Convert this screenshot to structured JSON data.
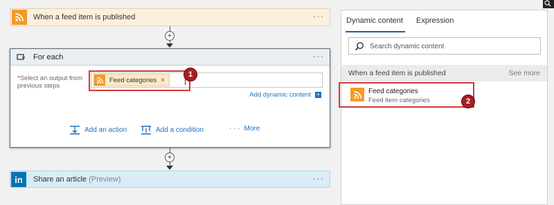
{
  "trigger": {
    "title": "When a feed item is published",
    "more": "···",
    "icon": "rss-icon"
  },
  "foreach": {
    "title": "For each",
    "more": "···",
    "required_star": "*",
    "field_label": "Select an output from previous steps",
    "token_label": "Feed categories",
    "token_remove": "×",
    "add_dynamic_content": "Add dynamic content",
    "add_dynamic_icon": "+",
    "actions": {
      "add_action": "Add an action",
      "add_condition": "Add a condition",
      "more": "More",
      "more_dots": "· · ·"
    }
  },
  "share": {
    "title": "Share an article",
    "preview": "(Preview)",
    "more": "···",
    "icon_text": "in"
  },
  "connectors": {
    "plus": "+"
  },
  "callouts": {
    "badge1": "1",
    "badge2": "2"
  },
  "panel": {
    "tabs": [
      "Dynamic content",
      "Expression"
    ],
    "search_placeholder": "Search dynamic content",
    "section_title": "When a feed item is published",
    "see_more": "See more",
    "item": {
      "name": "Feed categories",
      "description": "Feed item categories"
    }
  },
  "colors": {
    "rss": "#f39b26",
    "linkedin": "#0077b5",
    "link": "#1f6fbf",
    "callout_red": "#d03a3a",
    "badge": "#a81f24"
  }
}
